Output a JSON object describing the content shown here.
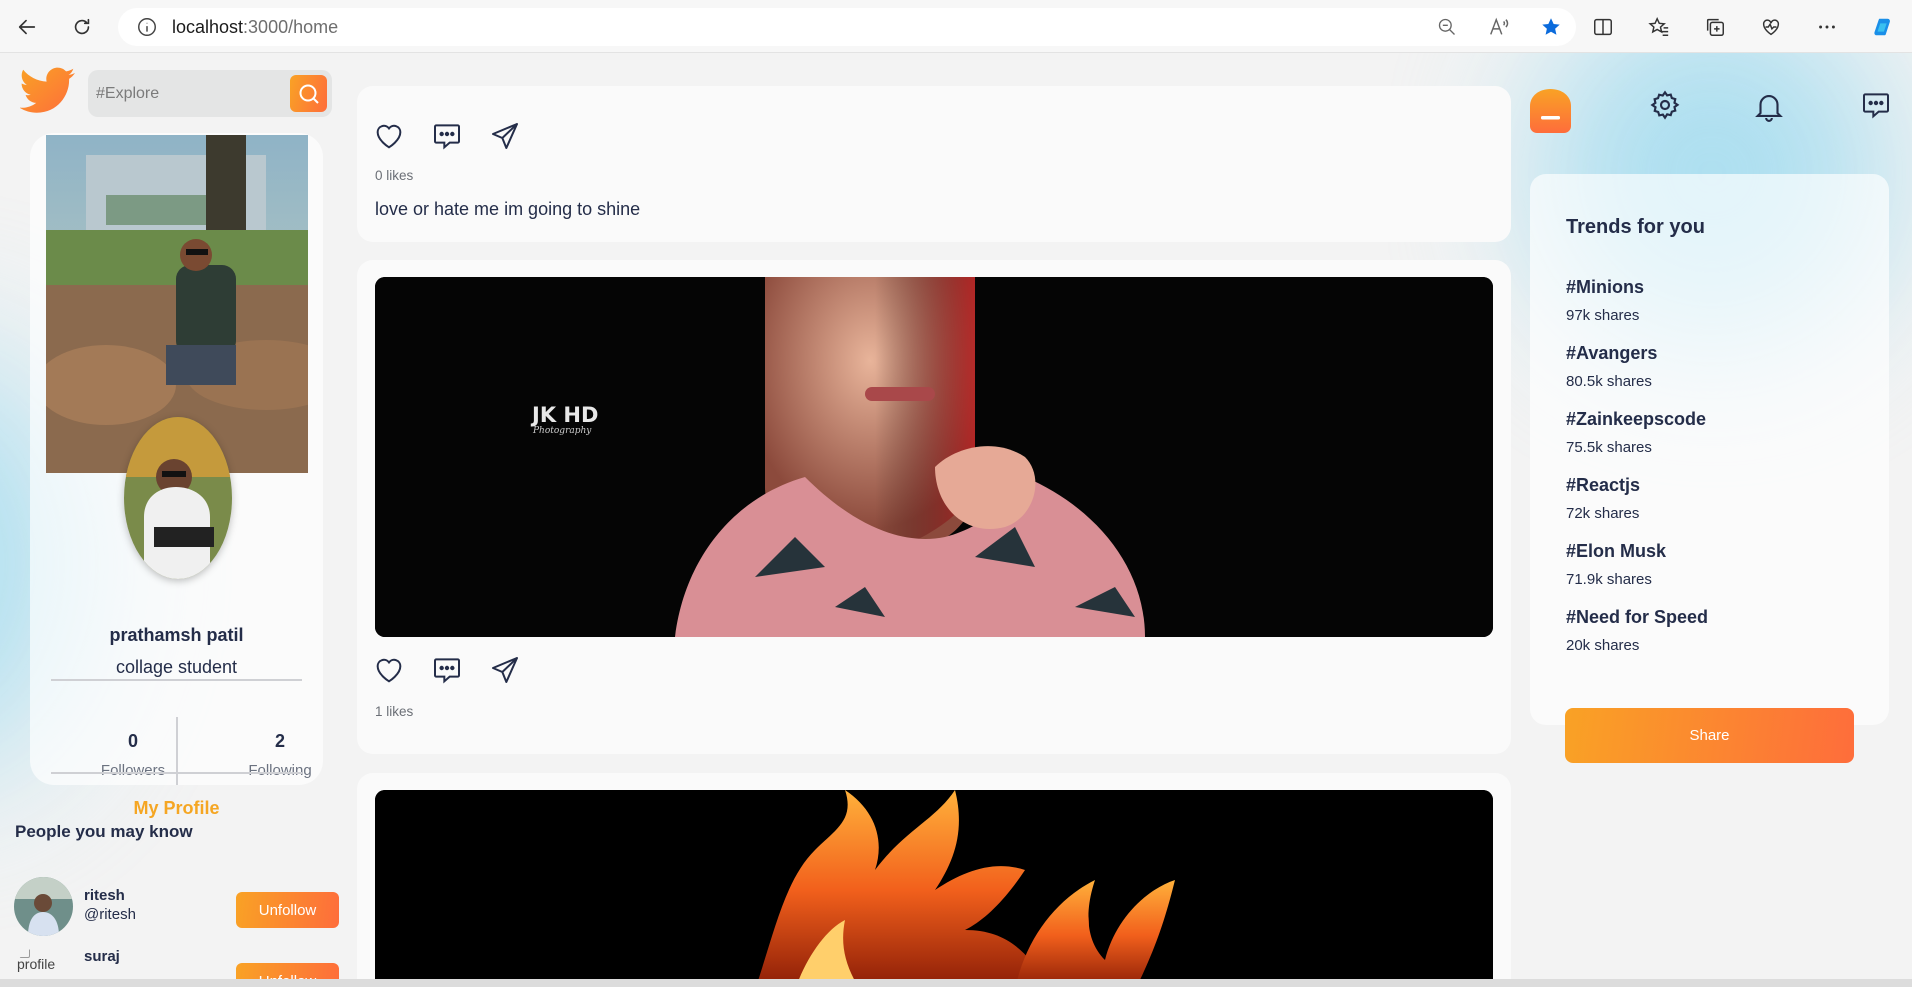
{
  "browser": {
    "url_host": "localhost",
    "url_path": ":3000/home"
  },
  "search": {
    "placeholder": "#Explore"
  },
  "profile": {
    "name": "prathamsh patil",
    "role": "collage student",
    "followers_count": "0",
    "followers_label": "Followers",
    "following_count": "2",
    "following_label": "Following",
    "my_profile_label": "My Profile"
  },
  "people": {
    "title": "People you may know",
    "items": [
      {
        "name": "ritesh",
        "handle": "@ritesh",
        "button": "Unfollow",
        "avatar_alt": ""
      },
      {
        "name": "suraj",
        "handle": "",
        "button": "Unfollow",
        "avatar_alt": "profile"
      }
    ]
  },
  "posts": [
    {
      "likes": "0 likes",
      "text": "love or hate me im going to shine"
    },
    {
      "likes": "1 likes",
      "watermark": "JK HD",
      "watermark_sub": "Photography"
    },
    {
      "likes": ""
    }
  ],
  "trends": {
    "title": "Trends for you",
    "items": [
      {
        "tag": "#Minions",
        "shares": "97k shares"
      },
      {
        "tag": "#Avangers",
        "shares": "80.5k shares"
      },
      {
        "tag": "#Zainkeepscode",
        "shares": "75.5k shares"
      },
      {
        "tag": "#Reactjs",
        "shares": "72k shares"
      },
      {
        "tag": "#Elon Musk",
        "shares": "71.9k shares"
      },
      {
        "tag": "#Need for Speed",
        "shares": "20k shares"
      }
    ]
  },
  "share_button": "Share",
  "colors": {
    "accent_start": "#f9a225",
    "accent_end": "#fe6d3b",
    "text": "#242d49",
    "link_blue": "#0b6bdc"
  },
  "icons": [
    "back-icon",
    "refresh-icon",
    "info-icon",
    "zoom-icon",
    "read-aloud-icon",
    "favorite-star-icon",
    "split-screen-icon",
    "favorites-icon",
    "collections-icon",
    "health-icon",
    "more-icon",
    "copilot-icon",
    "twitter-logo-icon",
    "search-icon",
    "heart-icon",
    "comment-icon",
    "send-icon",
    "home-icon",
    "gear-icon",
    "bell-icon",
    "message-icon"
  ]
}
